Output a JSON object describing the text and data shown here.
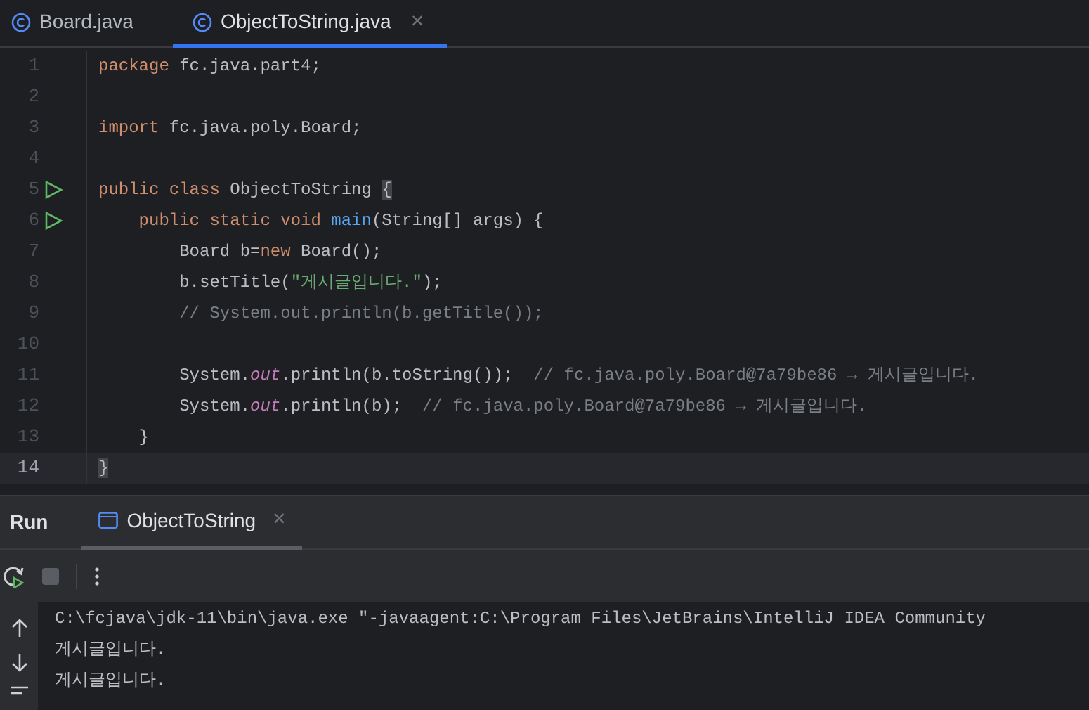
{
  "editor_tabs": [
    {
      "label": "Board.java",
      "selected": false,
      "closable": false
    },
    {
      "label": "ObjectToString.java",
      "selected": true,
      "closable": true,
      "close": "×"
    }
  ],
  "code_lines": [
    {
      "number": "1",
      "run": false,
      "current": false,
      "tokens": [
        {
          "kind": "keyword",
          "text": "package "
        },
        {
          "kind": "plain",
          "text": "fc.java.part4;"
        }
      ]
    },
    {
      "number": "2",
      "run": false,
      "current": false
    },
    {
      "number": "3",
      "run": false,
      "current": false,
      "tokens": [
        {
          "kind": "keyword",
          "text": "import "
        },
        {
          "kind": "plain",
          "text": "fc.java.poly.Board;"
        }
      ]
    },
    {
      "number": "4",
      "run": false,
      "current": false
    },
    {
      "number": "5",
      "run": true,
      "current": false,
      "tokens": [
        {
          "kind": "keyword",
          "text": "public class "
        },
        {
          "kind": "plain",
          "text": "ObjectToString "
        },
        {
          "kind": "brace",
          "text": "{"
        }
      ]
    },
    {
      "number": "6",
      "run": true,
      "current": false,
      "tokens": [
        {
          "kind": "keyword",
          "text": "    public static void "
        },
        {
          "kind": "method",
          "text": "main"
        },
        {
          "kind": "plain",
          "text": "(String[] args) {"
        }
      ]
    },
    {
      "number": "7",
      "run": false,
      "current": false,
      "tokens": [
        {
          "kind": "plain",
          "text": "        Board b="
        },
        {
          "kind": "keyword",
          "text": "new "
        },
        {
          "kind": "plain",
          "text": "Board();"
        }
      ]
    },
    {
      "number": "8",
      "run": false,
      "current": false,
      "tokens": [
        {
          "kind": "plain",
          "text": "        b.setTitle("
        },
        {
          "kind": "string",
          "text": "\"게시글입니다.\""
        },
        {
          "kind": "plain",
          "text": ");"
        }
      ]
    },
    {
      "number": "9",
      "run": false,
      "current": false,
      "tokens": [
        {
          "kind": "comment",
          "text": "        // System.out.println(b.getTitle());"
        }
      ]
    },
    {
      "number": "10",
      "run": false,
      "current": false
    },
    {
      "number": "11",
      "run": false,
      "current": false,
      "tokens": [
        {
          "kind": "plain",
          "text": "        System."
        },
        {
          "kind": "field",
          "text": "out"
        },
        {
          "kind": "plain",
          "text": ".println(b.toString());  "
        },
        {
          "kind": "comment",
          "text": "// fc.java.poly.Board@7a79be86 → 게시글입니다."
        }
      ]
    },
    {
      "number": "12",
      "run": false,
      "current": false,
      "tokens": [
        {
          "kind": "plain",
          "text": "        System."
        },
        {
          "kind": "field",
          "text": "out"
        },
        {
          "kind": "plain",
          "text": ".println(b);  "
        },
        {
          "kind": "comment",
          "text": "// fc.java.poly.Board@7a79be86 → 게시글입니다."
        }
      ]
    },
    {
      "number": "13",
      "run": false,
      "current": false,
      "tokens": [
        {
          "kind": "plain",
          "text": "    }"
        }
      ]
    },
    {
      "number": "14",
      "run": false,
      "current": true,
      "tokens": [
        {
          "kind": "brace",
          "text": "}"
        }
      ]
    }
  ],
  "run_panel": {
    "title": "Run",
    "tabs": [
      {
        "label": "ObjectToString",
        "selected": true,
        "close": "×"
      }
    ],
    "console_lines": [
      "C:\\fcjava\\jdk-11\\bin\\java.exe \"-javaagent:C:\\Program Files\\JetBrains\\IntelliJ IDEA Community",
      "게시글입니다.",
      "게시글입니다."
    ]
  }
}
